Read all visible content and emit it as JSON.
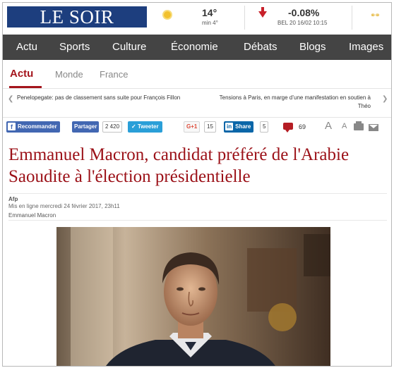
{
  "header": {
    "logo": "LE SOIR",
    "weather": {
      "temp": "14°",
      "min": "min 4°"
    },
    "bourse": {
      "change": "-0.08%",
      "time": "BEL 20 16/02 10:15"
    }
  },
  "nav": {
    "items": [
      "Actu",
      "Sports",
      "Culture",
      "Économie",
      "Débats",
      "Blogs",
      "Images"
    ]
  },
  "subnav": {
    "items": [
      "Actu",
      "Monde",
      "France"
    ]
  },
  "prevnext": {
    "prev": "Penelopegate: pas de classement sans suite pour François Fillon",
    "next": "Tensions à Paris, en marge d’une manifestation en soutien à Théo"
  },
  "share": {
    "recommend": "Recommander",
    "share_fb": "Partager",
    "fb_count": "2 420",
    "tweet": "Tweeter",
    "gplus": "G+1",
    "gplus_count": "15",
    "linkedin": "Share",
    "linkedin_count": "5",
    "comments": "69",
    "font_up": "A",
    "font_down": "A"
  },
  "article": {
    "title": "Emmanuel Macron, candidat préféré de l'Arabie Saoudite à l'élection présidentielle",
    "source": "Afp",
    "published": "Mis en ligne mercredi 24 février 2017, 23h11",
    "author": "Emmanuel Macron"
  },
  "colors": {
    "brand": "#1d3e7e",
    "accent": "#a4141c",
    "nav": "#444444"
  }
}
